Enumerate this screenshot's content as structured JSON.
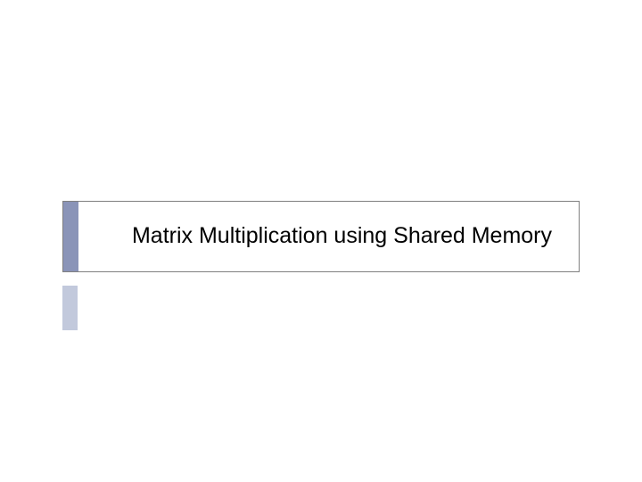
{
  "slide": {
    "title": "Matrix Multiplication using Shared Memory"
  }
}
